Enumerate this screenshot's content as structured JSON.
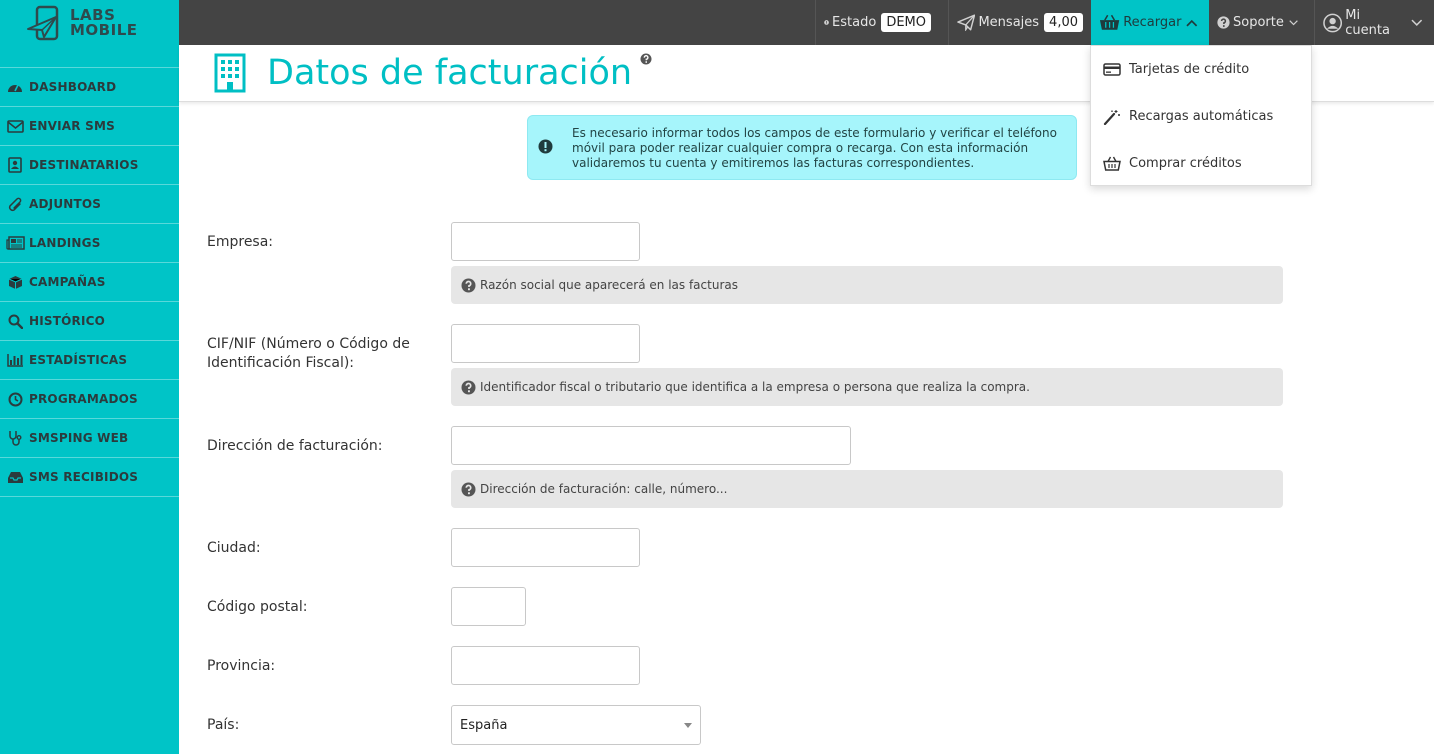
{
  "logo": {
    "line1": "LABS",
    "line2": "MOBILE"
  },
  "sidebar": {
    "items": [
      {
        "label": "DASHBOARD",
        "icon": "dashboard-icon"
      },
      {
        "label": "ENVIAR SMS",
        "icon": "envelope-icon"
      },
      {
        "label": "DESTINATARIOS",
        "icon": "contact-book-icon"
      },
      {
        "label": "ADJUNTOS",
        "icon": "paperclip-icon"
      },
      {
        "label": "LANDINGS",
        "icon": "newspaper-icon"
      },
      {
        "label": "CAMPAÑAS",
        "icon": "cube-icon"
      },
      {
        "label": "HISTÓRICO",
        "icon": "search-icon"
      },
      {
        "label": "ESTADÍSTICAS",
        "icon": "bar-chart-icon"
      },
      {
        "label": "PROGRAMADOS",
        "icon": "clock-icon"
      },
      {
        "label": "SMSPING WEB",
        "icon": "stethoscope-icon"
      },
      {
        "label": "SMS RECIBIDOS",
        "icon": "inbox-icon"
      }
    ]
  },
  "topbar": {
    "estado_label": "Estado",
    "estado_value": "DEMO",
    "mensajes_label": "Mensajes",
    "mensajes_value": "4,00",
    "recargar_label": "Recargar",
    "soporte_label": "Soporte",
    "cuenta_label": "Mi cuenta"
  },
  "recargar_menu": {
    "items": [
      {
        "label": "Tarjetas de crédito",
        "icon": "credit-card-icon"
      },
      {
        "label": "Recargas automáticas",
        "icon": "magic-wand-icon"
      },
      {
        "label": "Comprar créditos",
        "icon": "basket-icon"
      }
    ]
  },
  "page": {
    "title": "Datos de facturación"
  },
  "alert": {
    "line1": "Es necesario informar todos los campos de este formulario y verificar el teléfono",
    "line2": "móvil para poder realizar cualquier compra o recarga. Con esta información",
    "line3": "validaremos tu cuenta y emitiremos las facturas correspondientes."
  },
  "form": {
    "empresa": {
      "label": "Empresa:",
      "value": "",
      "help": "Razón social que aparecerá en las facturas"
    },
    "cif": {
      "label_line1": "CIF/NIF (Número o Código de",
      "label_line2": "Identificación Fiscal):",
      "value": "",
      "help": "Identificador fiscal o tributario que identifica a la empresa o persona que realiza la compra."
    },
    "direccion": {
      "label": "Dirección de facturación:",
      "value": "",
      "help": "Dirección de facturación: calle, número..."
    },
    "ciudad": {
      "label": "Ciudad:",
      "value": ""
    },
    "cp": {
      "label": "Código postal:",
      "value": ""
    },
    "provincia": {
      "label": "Provincia:",
      "value": ""
    },
    "pais": {
      "label": "País:",
      "value": "España"
    }
  },
  "colors": {
    "accent": "#00c4c7",
    "topbar": "#444444",
    "alert_bg": "#a6f5fb",
    "title": "#00bfc4"
  }
}
